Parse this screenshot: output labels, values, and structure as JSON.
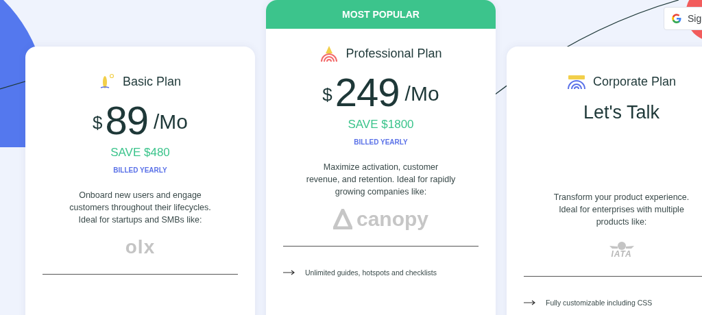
{
  "signin_button": {
    "label": "Sig"
  },
  "plans": [
    {
      "kind": "priced",
      "name": "Basic Plan",
      "currency": "$",
      "price": "89",
      "period": "/Mo",
      "save": "SAVE $480",
      "billing": "BILLED YEARLY",
      "description": "Onboard new users and engage\ncustomers throughout their lifecycles.\nIdeal for startups and SMBs like:",
      "logo": "olx"
    },
    {
      "kind": "priced",
      "badge": "MOST POPULAR",
      "name": "Professional Plan",
      "currency": "$",
      "price": "249",
      "period": "/Mo",
      "save": "SAVE $1800",
      "billing": "BILLED YEARLY",
      "description": "Maximize activation, customer\nrevenue, and retention. Ideal for rapidly\ngrowing companies like:",
      "logo": "canopy",
      "features": [
        "Unlimited guides, hotspots and checklists"
      ]
    },
    {
      "kind": "contact",
      "name": "Corporate Plan",
      "headline": "Let's Talk",
      "description": "Transform your product experience.\nIdeal for enterprises with multiple\nproducts like:",
      "logo": "IATA",
      "features": [
        "Fully customizable including CSS"
      ]
    }
  ]
}
